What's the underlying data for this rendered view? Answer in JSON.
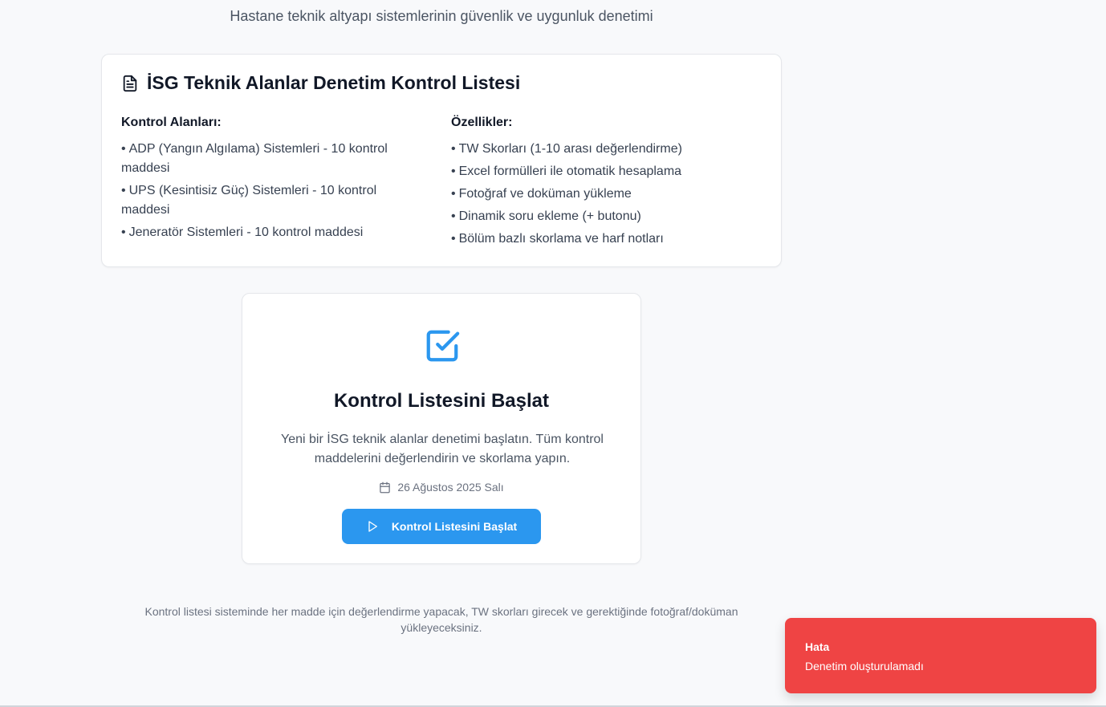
{
  "header": {
    "subtitle": "Hastane teknik altyapı sistemlerinin güvenlik ve uygunluk denetimi"
  },
  "info_card": {
    "icon": "document-icon",
    "title": "İSG Teknik Alanlar Denetim Kontrol Listesi",
    "left_heading": "Kontrol Alanları:",
    "left_items": [
      "ADP (Yangın Algılama) Sistemleri - 10 kontrol maddesi",
      "UPS (Kesintisiz Güç) Sistemleri - 10 kontrol maddesi",
      "Jeneratör Sistemleri - 10 kontrol maddesi"
    ],
    "right_heading": "Özellikler:",
    "right_items": [
      "TW Skorları (1-10 arası değerlendirme)",
      "Excel formülleri ile otomatik hesaplama",
      "Fotoğraf ve doküman yükleme",
      "Dinamik soru ekleme (+ butonu)",
      "Bölüm bazlı skorlama ve harf notları"
    ],
    "bullet": "•"
  },
  "start_card": {
    "icon": "checkbox-icon",
    "title": "Kontrol Listesini Başlat",
    "description": "Yeni bir İSG teknik alanlar denetimi başlatın. Tüm kontrol maddelerini değerlendirin ve skorlama yapın.",
    "date_icon": "calendar-icon",
    "date": "26 Ağustos 2025 Salı",
    "button_icon": "play-icon",
    "button_label": "Kontrol Listesini Başlat"
  },
  "footer": {
    "note": "Kontrol listesi sisteminde her madde için değerlendirme yapacak, TW skorları girecek ve gerektiğinde fotoğraf/doküman yükleyeceksiniz."
  },
  "toast": {
    "title": "Hata",
    "message": "Denetim oluşturulamadı",
    "color": "#ef4444"
  },
  "colors": {
    "accent": "#2b97ef",
    "error": "#ef4444",
    "background": "#f8f9fb"
  }
}
